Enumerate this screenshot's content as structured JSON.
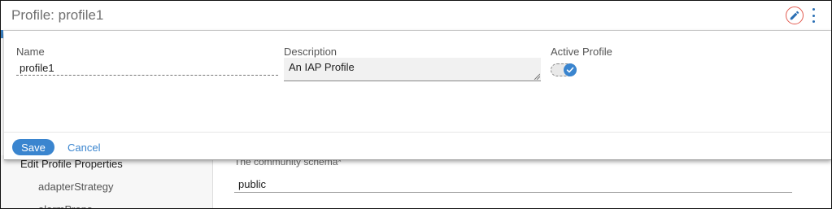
{
  "header": {
    "title": "Profile: profile1",
    "edit_icon": "pencil-icon",
    "menu_icon": "more-vertical-icon",
    "accent_color": "#3a85cf",
    "highlight_color": "#e25b50"
  },
  "dialog": {
    "name_label": "Name",
    "name_value": "profile1",
    "description_label": "Description",
    "description_value": "An IAP Profile",
    "active_label": "Active Profile",
    "active_checked": true,
    "save_label": "Save",
    "cancel_label": "Cancel"
  },
  "background": {
    "section_title": "Edit Profile Properties",
    "items": [
      "adapterStrategy",
      "alarmProps"
    ],
    "field_label": "The community schema*",
    "field_value": "public"
  }
}
